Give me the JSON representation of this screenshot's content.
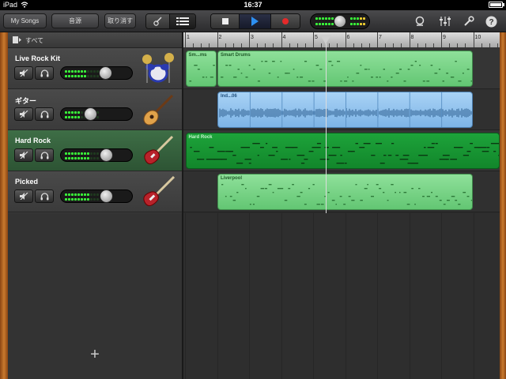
{
  "status_bar": {
    "device": "iPad",
    "time": "16:37"
  },
  "toolbar": {
    "my_songs": "My Songs",
    "sound": "音源",
    "undo": "取り消す",
    "accent_play": "#2d8ff0",
    "accent_record": "#e52a2a"
  },
  "icons": [
    "wifi-icon",
    "battery-icon",
    "guitar-view-icon",
    "tracks-view-icon",
    "stop-icon",
    "play-icon",
    "record-icon",
    "loop-icon",
    "mixer-icon",
    "wrench-icon",
    "help-icon",
    "mute-icon",
    "headphones-icon",
    "add-icon",
    "all-tracks-icon"
  ],
  "all_tracks_label": "すべて",
  "ruler": {
    "bars": [
      "1",
      "2",
      "3",
      "4",
      "5",
      "6",
      "7",
      "8",
      "9",
      "10"
    ],
    "playhead_bar": 5.4
  },
  "tracks": [
    {
      "name": "Live Rock Kit",
      "instrument": "drums-icon",
      "volume": 0.68,
      "selected": false
    },
    {
      "name": "ギター",
      "instrument": "acoustic-guitar-icon",
      "volume": 0.43,
      "selected": false
    },
    {
      "name": "Hard Rock",
      "instrument": "electric-guitar-icon",
      "volume": 0.7,
      "selected": true
    },
    {
      "name": "Picked",
      "instrument": "bass-icon",
      "volume": 0.7,
      "selected": false
    }
  ],
  "regions": [
    {
      "track": 0,
      "name": "Sm...ms",
      "start_bar": 1.0,
      "end_bar": 2.0,
      "color": "green"
    },
    {
      "track": 0,
      "name": "Smart Drums",
      "start_bar": 2.0,
      "end_bar": 10.0,
      "color": "green"
    },
    {
      "track": 1,
      "name": "Ind...06",
      "start_bar": 2.0,
      "end_bar": 10.0,
      "color": "blue"
    },
    {
      "track": 2,
      "name": "Hard Rock",
      "start_bar": 1.0,
      "end_bar": 11.0,
      "color": "dark"
    },
    {
      "track": 3,
      "name": "Liverpool",
      "start_bar": 2.0,
      "end_bar": 10.0,
      "color": "green"
    }
  ]
}
